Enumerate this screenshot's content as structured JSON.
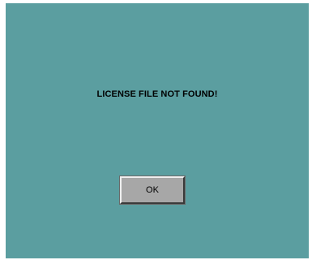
{
  "dialog": {
    "message": "LICENSE FILE NOT FOUND!",
    "ok_label": "OK",
    "background_color": "#5b9ea0",
    "button_color": "#a7a7a7"
  }
}
